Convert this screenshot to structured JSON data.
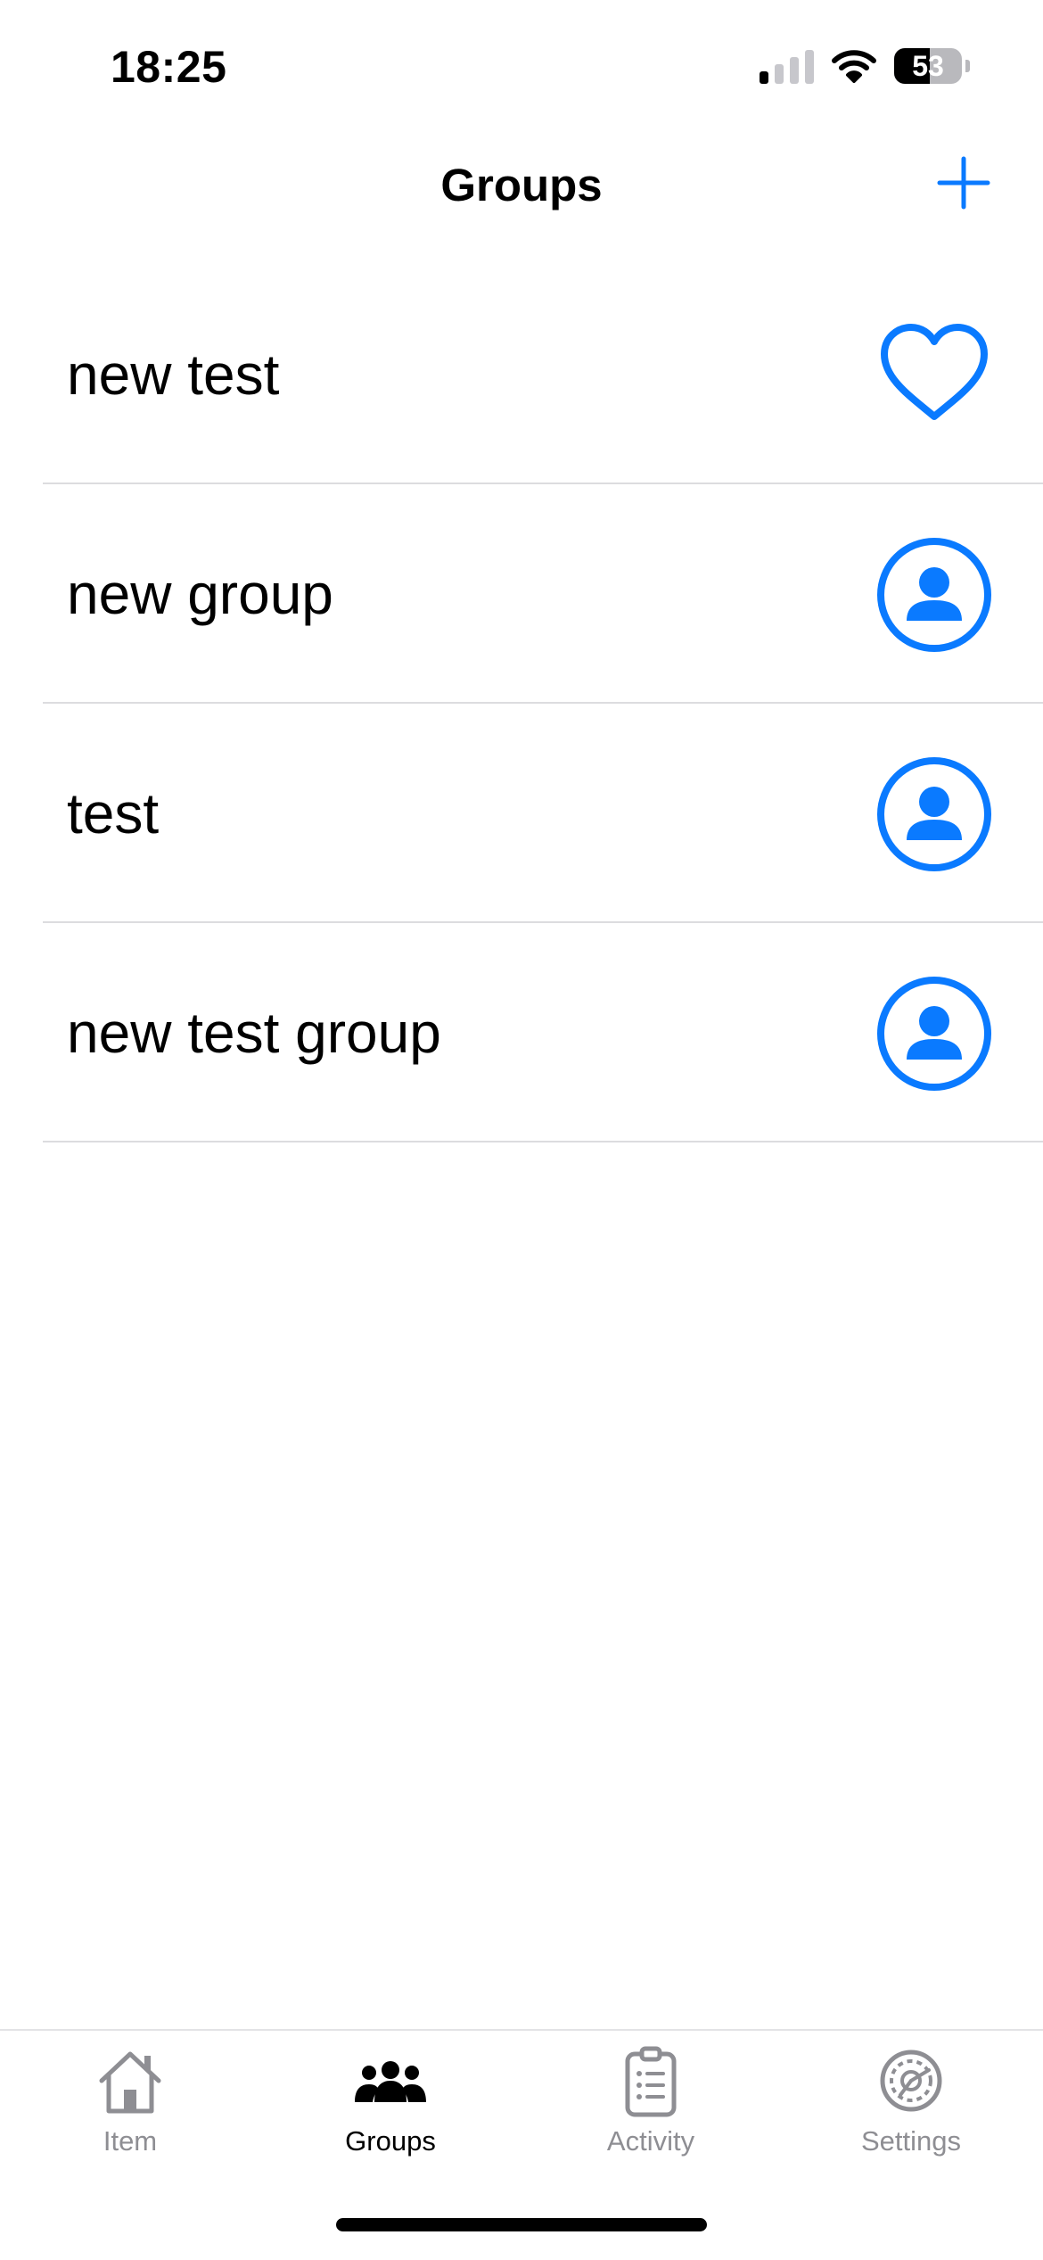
{
  "status": {
    "time": "18:25",
    "battery": "53",
    "battery_level_percent": 53,
    "signal_bars_on": 1,
    "signal_bars_total": 4
  },
  "nav": {
    "title": "Groups",
    "add_icon": "plus-icon"
  },
  "groups": [
    {
      "name": "new test",
      "icon": "heart-icon"
    },
    {
      "name": "new group",
      "icon": "person-circle-icon"
    },
    {
      "name": "test",
      "icon": "person-circle-icon"
    },
    {
      "name": "new test group",
      "icon": "person-circle-icon"
    }
  ],
  "tabs": [
    {
      "label": "Item",
      "icon": "house-icon",
      "active": false
    },
    {
      "label": "Groups",
      "icon": "people-icon",
      "active": true
    },
    {
      "label": "Activity",
      "icon": "clipboard-list-icon",
      "active": false
    },
    {
      "label": "Settings",
      "icon": "gear-icon",
      "active": false
    }
  ],
  "colors": {
    "accent": "#0a7aff",
    "inactive": "#8e8e93",
    "active_tab": "#000000",
    "separator": "#dcdcdf"
  }
}
